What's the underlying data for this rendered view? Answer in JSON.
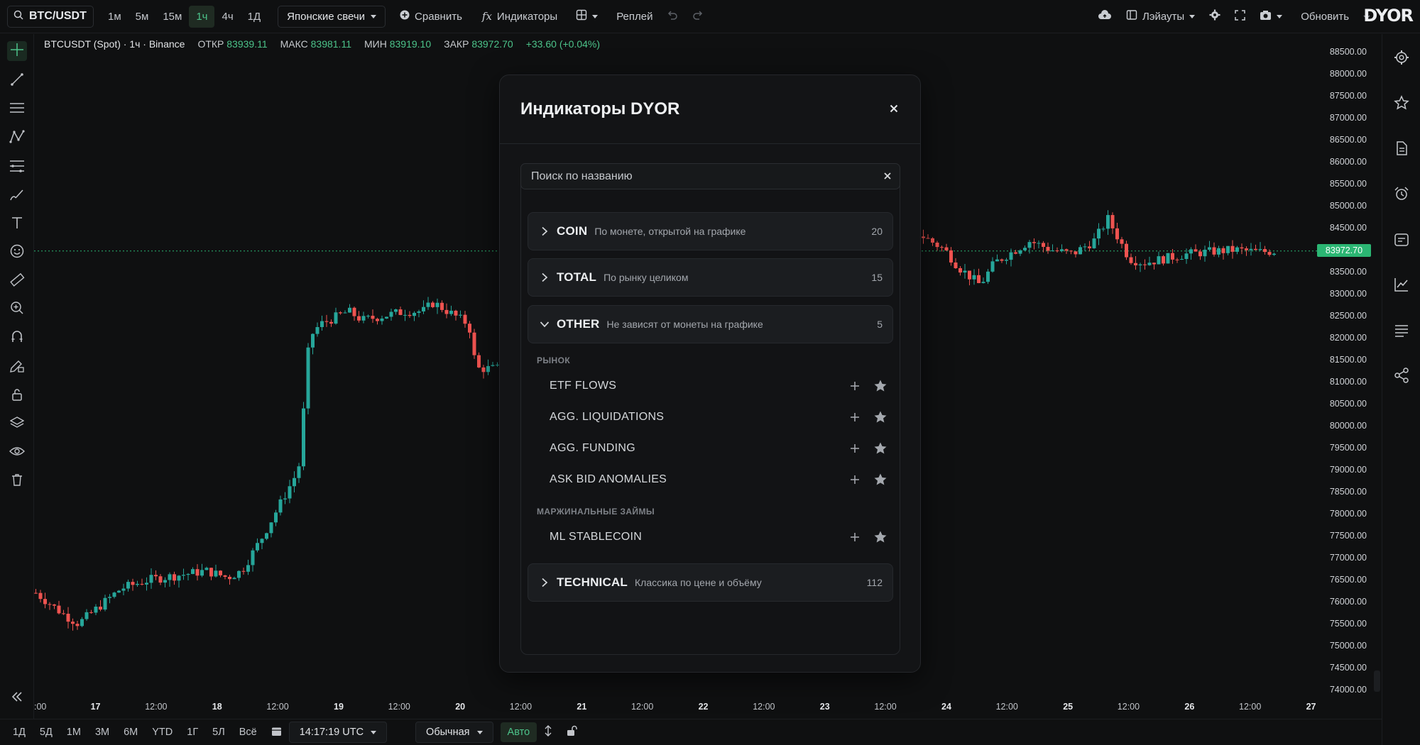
{
  "topbar": {
    "symbol": "BTC/USDT",
    "timeframes": [
      "1м",
      "5м",
      "15м",
      "1ч",
      "4ч",
      "1Д"
    ],
    "active_timeframe": "1ч",
    "chart_type": "Японские свечи",
    "compare_label": "Сравнить",
    "indicators_label": "Индикаторы",
    "replay_label": "Реплей",
    "layouts_label": "Лэйауты",
    "update_label": "Обновить",
    "logo": "DYOR"
  },
  "legend": {
    "title": "BTCUSDT (Spot) · 1ч · Binance",
    "open_label": "ОТКР",
    "open": "83939.11",
    "high_label": "МАКС",
    "high": "83981.11",
    "low_label": "МИН",
    "low": "83919.10",
    "close_label": "ЗАКР",
    "close": "83972.70",
    "change": "+33.60 (+0.04%)"
  },
  "price_axis": {
    "labels": [
      "88500.00",
      "88000.00",
      "87500.00",
      "87000.00",
      "86500.00",
      "86000.00",
      "85500.00",
      "85000.00",
      "84500.00",
      "84000.00",
      "83500.00",
      "83000.00",
      "82500.00",
      "82000.00",
      "81500.00",
      "81000.00",
      "80500.00",
      "80000.00",
      "79500.00",
      "79000.00",
      "78500.00",
      "78000.00",
      "77500.00",
      "77000.00",
      "76500.00",
      "76000.00",
      "75500.00",
      "75000.00",
      "74500.00",
      "74000.00"
    ],
    "last_price": "83972.70"
  },
  "time_axis": {
    "labels": [
      ":00",
      "17",
      "12:00",
      "18",
      "12:00",
      "19",
      "12:00",
      "20",
      "12:00",
      "21",
      "12:00",
      "22",
      "12:00",
      "23",
      "12:00",
      "24",
      "12:00",
      "25",
      "12:00",
      "26",
      "12:00",
      "27"
    ]
  },
  "bottombar": {
    "ranges": [
      "1Д",
      "5Д",
      "1М",
      "3М",
      "6М",
      "YTD",
      "1Г",
      "5Л",
      "Всё"
    ],
    "time": "14:17:19 UTC",
    "scale_mode": "Обычная",
    "auto_label": "Авто"
  },
  "modal": {
    "title": "Индикаторы DYOR",
    "search_placeholder": "Поиск по названию",
    "categories": [
      {
        "name": "COIN",
        "desc": "По монете, открытой на графике",
        "count": "20",
        "expanded": false
      },
      {
        "name": "TOTAL",
        "desc": "По рынку целиком",
        "count": "15",
        "expanded": false
      },
      {
        "name": "OTHER",
        "desc": "Не зависят от монеты на графике",
        "count": "5",
        "expanded": true
      },
      {
        "name": "TECHNICAL",
        "desc": "Классика по цене и объёму",
        "count": "112",
        "expanded": false
      }
    ],
    "groups": [
      {
        "label": "РЫНОК",
        "items": [
          "ETF FLOWS",
          "AGG. LIQUIDATIONS",
          "AGG. FUNDING",
          "ASK BID ANOMALIES"
        ]
      },
      {
        "label": "МАРЖИНАЛЬНЫЕ ЗАЙМЫ",
        "items": [
          "ML STABLECOIN"
        ]
      }
    ]
  },
  "colors": {
    "up": "#26a69a",
    "down": "#ef5350",
    "accent": "#4cc38a",
    "background": "#0f1011"
  }
}
